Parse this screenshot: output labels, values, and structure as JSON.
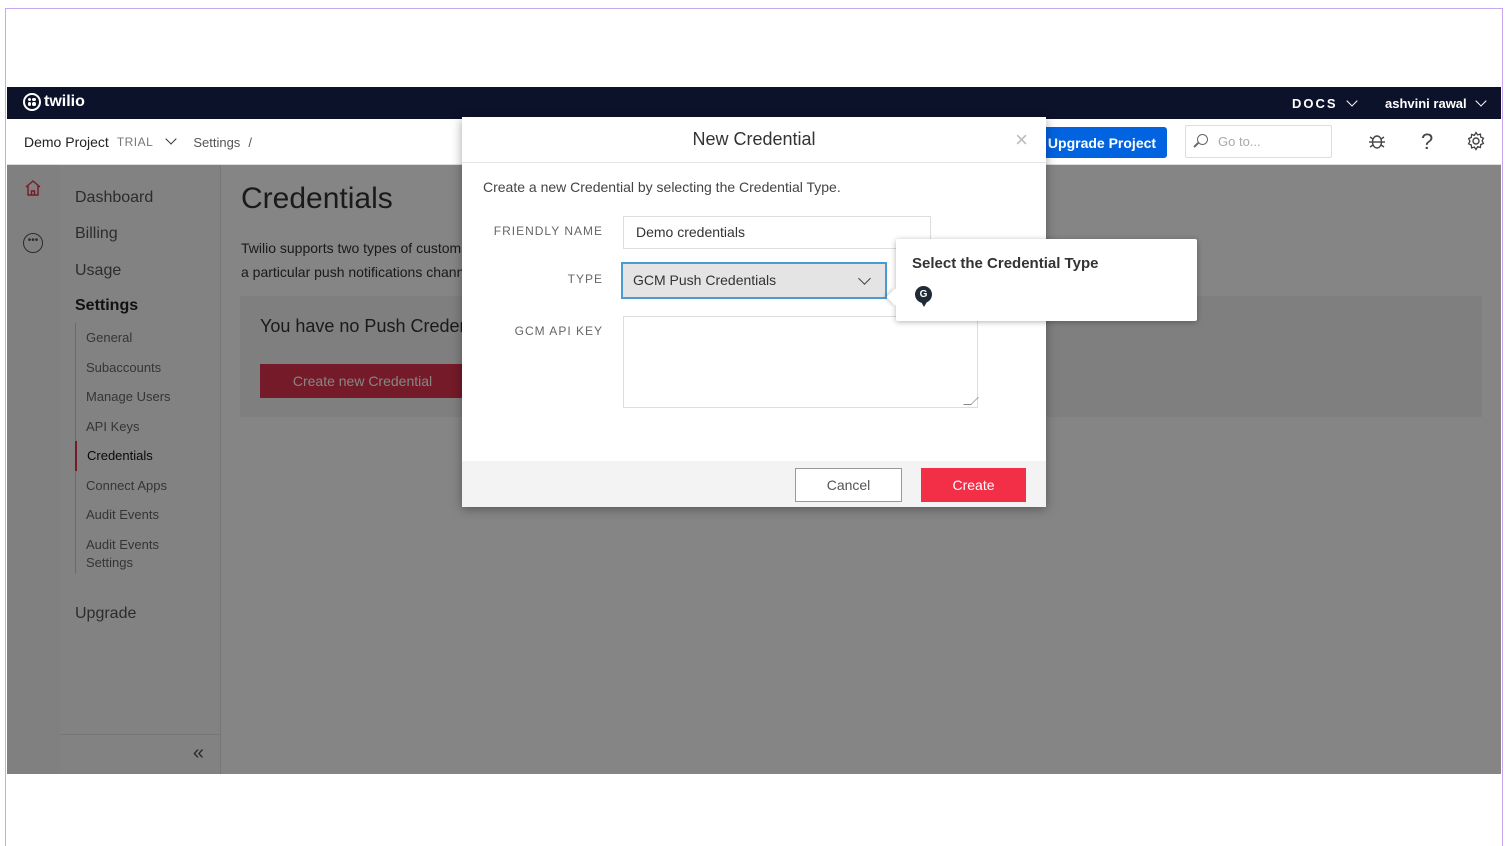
{
  "topbar": {
    "brand": "twilio",
    "docs_label": "DOCS",
    "user_name": "ashvini rawal"
  },
  "subbar": {
    "project_name": "Demo Project",
    "project_badge": "TRIAL",
    "breadcrumb_settings": "Settings",
    "breadcrumb_sep": "/",
    "upgrade_label": "Upgrade Project",
    "goto_placeholder": "Go to..."
  },
  "sidebar": {
    "items": [
      {
        "label": "Dashboard"
      },
      {
        "label": "Billing"
      },
      {
        "label": "Usage"
      },
      {
        "label": "Settings"
      },
      {
        "label": "Upgrade"
      }
    ],
    "settings_items": [
      {
        "label": "General"
      },
      {
        "label": "Subaccounts"
      },
      {
        "label": "Manage Users"
      },
      {
        "label": "API Keys"
      },
      {
        "label": "Credentials"
      },
      {
        "label": "Connect Apps"
      },
      {
        "label": "Audit Events"
      },
      {
        "label": "Audit Events Settings"
      }
    ],
    "collapse_glyph": "«"
  },
  "main": {
    "title": "Credentials",
    "intro_line1": "Twilio supports two types of custom credentials: Push Credentials and Public Keys. Push Credentials are vendor specific credential record for",
    "intro_line2": "a particular push notifications channel.",
    "empty_text": "You have no Push Credentials",
    "create_button": "Create new Credential"
  },
  "modal": {
    "title": "New Credential",
    "close_glyph": "×",
    "description": "Create a new Credential by selecting the Credential Type.",
    "friendly_name_label": "FRIENDLY NAME",
    "friendly_name_value": "Demo credentials",
    "type_label": "TYPE",
    "type_value": "GCM Push Credentials",
    "api_key_label": "GCM API KEY",
    "api_key_value": "",
    "cancel_label": "Cancel",
    "create_label": "Create"
  },
  "tooltip": {
    "title": "Select the Credential Type",
    "badge_letter": "G"
  },
  "colors": {
    "topbar_bg": "#0d122b",
    "upgrade_blue": "#0263e0",
    "create_red": "#f22f46",
    "accent_red": "#e0334d",
    "select_border": "#4a9bd3"
  },
  "icons": [
    "twilio-logo-icon",
    "chevron-down-icon",
    "search-icon",
    "bug-icon",
    "help-icon",
    "gear-icon",
    "home-icon",
    "more-icon",
    "close-icon",
    "collapse-icon",
    "guide-pin-icon"
  ]
}
